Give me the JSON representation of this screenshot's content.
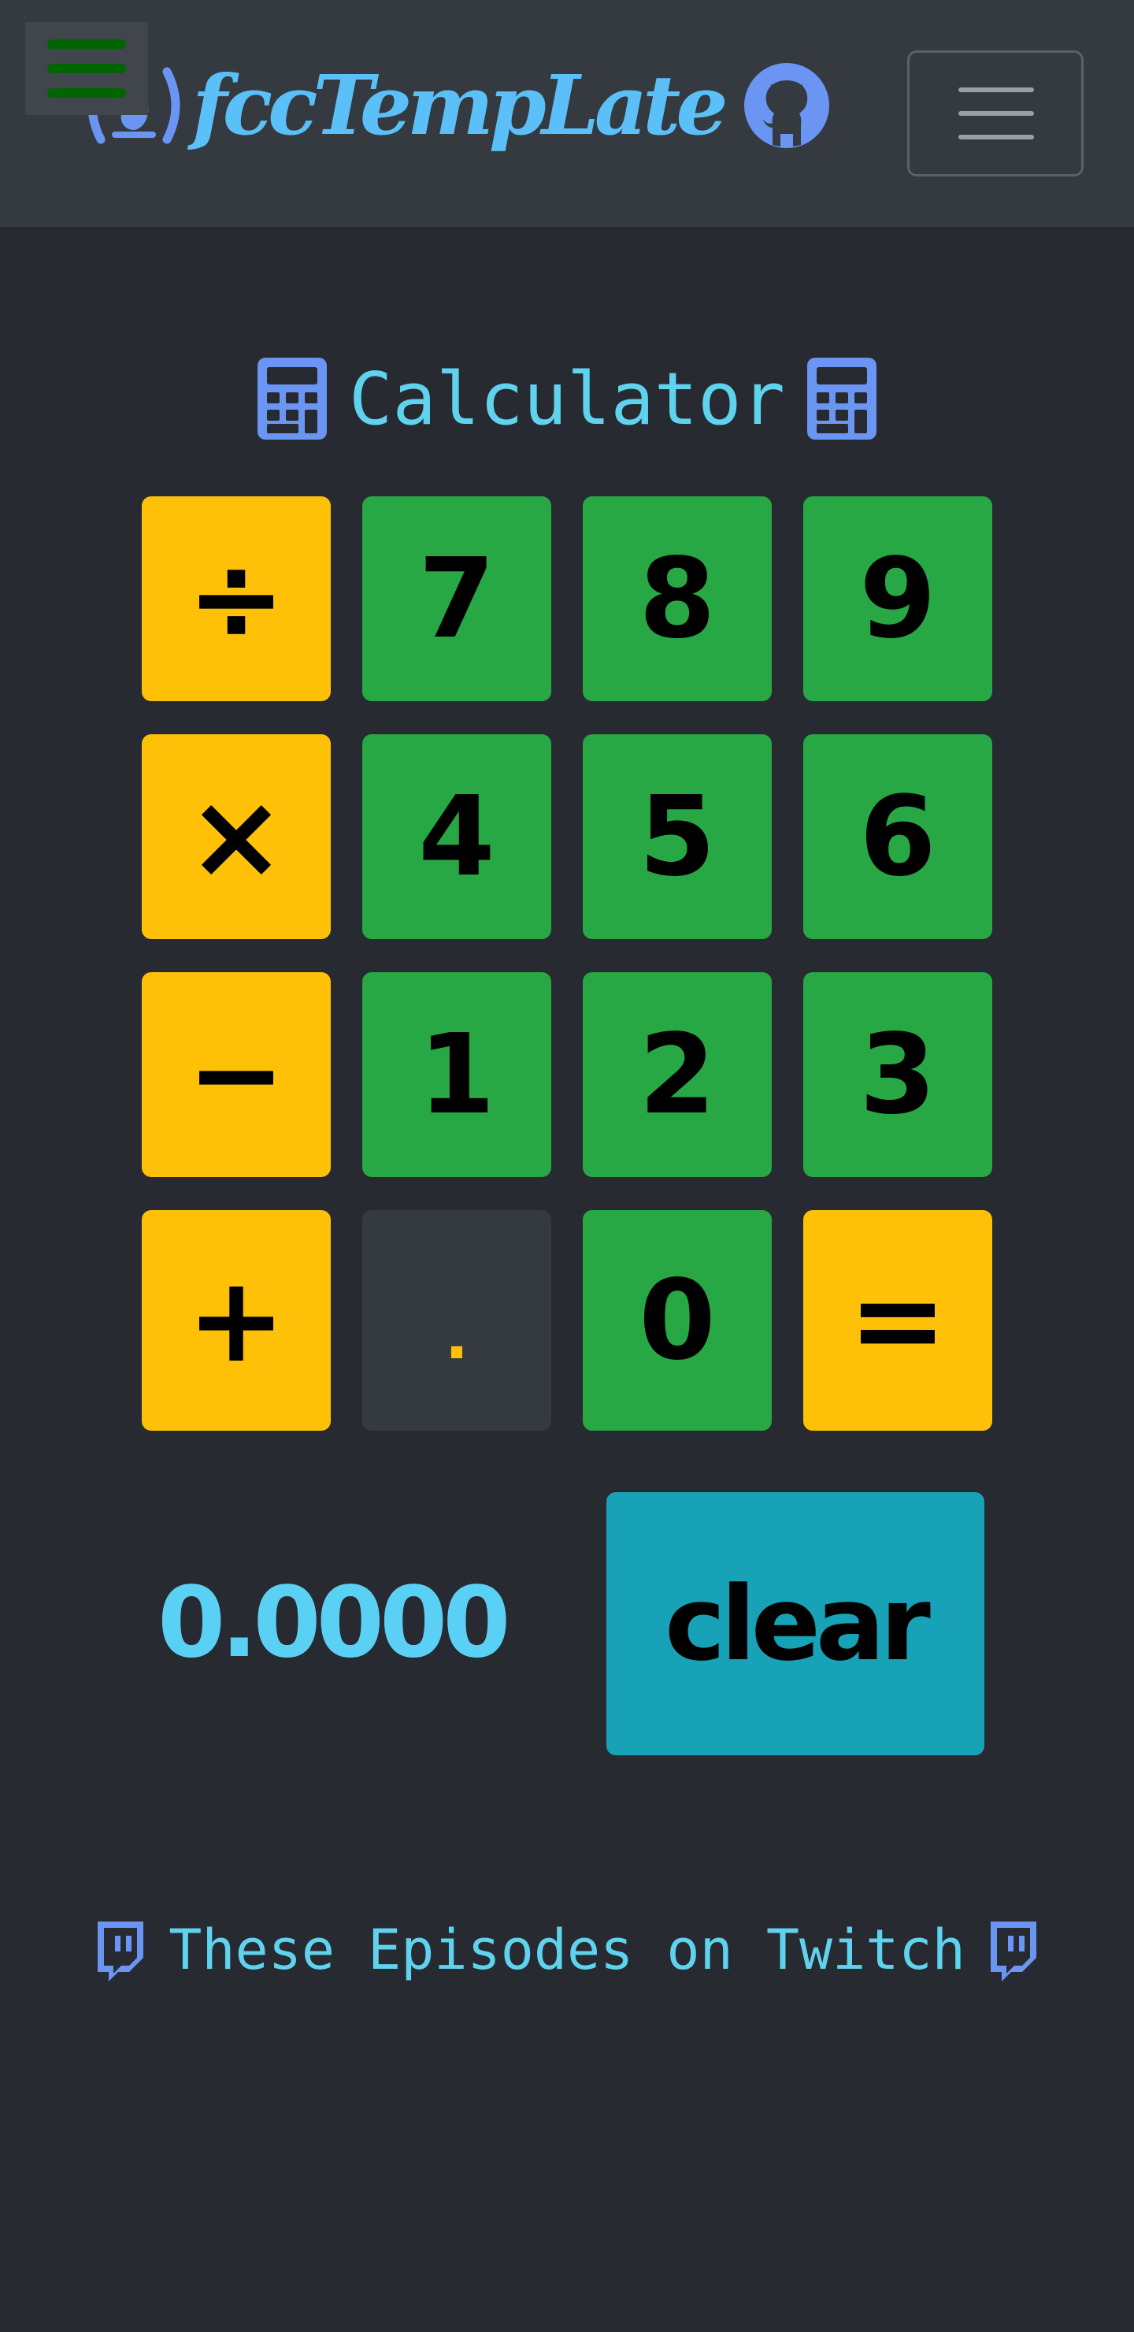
{
  "navbar": {
    "brand_text": "fccTempLate",
    "icons": {
      "left": "freecodecamp-icon",
      "right": "github-icon",
      "side_toggle": "hamburger-icon",
      "menu": "hamburger-icon"
    }
  },
  "calculator": {
    "title": "Calculator",
    "title_icon": "calculator-icon",
    "keys": {
      "divide": "÷",
      "multiply": "×",
      "subtract": "−",
      "add": "+",
      "seven": "7",
      "eight": "8",
      "nine": "9",
      "four": "4",
      "five": "5",
      "six": "6",
      "one": "1",
      "two": "2",
      "three": "3",
      "decimal": ".",
      "zero": "0",
      "equals": "="
    },
    "display": "0.0000",
    "clear_label": "clear"
  },
  "footer": {
    "twitch_text": "These Episodes on Twitch",
    "twitch_icon": "twitch-icon"
  },
  "colors": {
    "background": "#272a31",
    "navbar": "#343a40",
    "accent_text": "#5bc0f8",
    "icon_blue": "#6b95f3",
    "operator": "#ffc107",
    "number": "#28a745",
    "clear": "#17a2b8"
  }
}
